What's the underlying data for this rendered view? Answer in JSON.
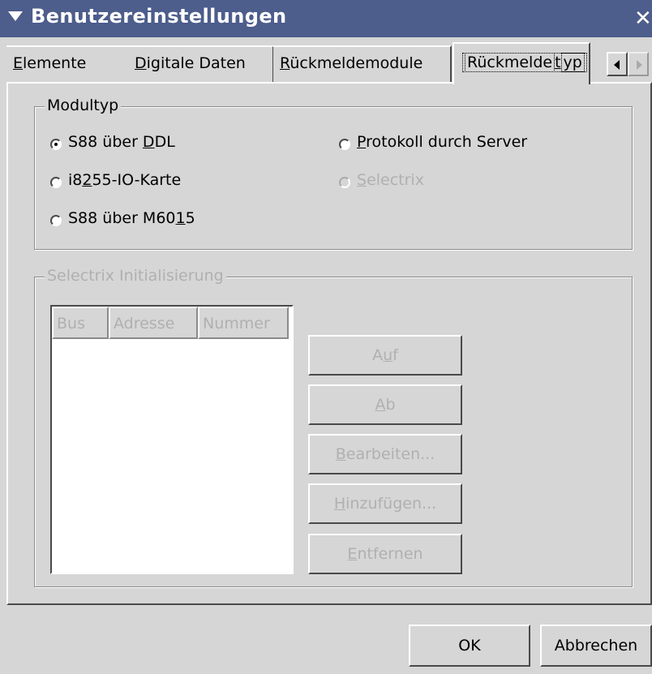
{
  "window": {
    "title": "Benutzereinstellungen",
    "close_glyph": "✕"
  },
  "tabs": [
    {
      "pre": "",
      "u": "E",
      "post": "lemente"
    },
    {
      "pre": "",
      "u": "D",
      "post": "igitale Daten"
    },
    {
      "pre": "",
      "u": "R",
      "post": "ückmeldemodule"
    },
    {
      "pre": "Rückmelde",
      "u": "t",
      "post": "yp"
    }
  ],
  "active_tab": "Rückmeldetyp",
  "modultyp": {
    "legend": "Modultyp",
    "options": [
      {
        "pre": "S88 über ",
        "u": "D",
        "post": "DL",
        "selected": true,
        "enabled": true
      },
      {
        "pre": "i8",
        "u": "2",
        "post": "55-IO-Karte",
        "selected": false,
        "enabled": true
      },
      {
        "pre": "S88 über M60",
        "u": "1",
        "post": "5",
        "selected": false,
        "enabled": true
      },
      {
        "pre": "",
        "u": "P",
        "post": "rotokoll durch Server",
        "selected": false,
        "enabled": true
      },
      {
        "pre": "",
        "u": "S",
        "post": "electrix",
        "selected": false,
        "enabled": false
      }
    ]
  },
  "selectrix": {
    "legend": "Selectrix Initialisierung",
    "columns": [
      "Bus",
      "Adresse",
      "Nummer"
    ],
    "rows": [],
    "buttons": [
      {
        "pre": "A",
        "u": "u",
        "post": "f"
      },
      {
        "pre": "",
        "u": "A",
        "post": "b"
      },
      {
        "pre": "",
        "u": "B",
        "post": "earbeiten..."
      },
      {
        "pre": "",
        "u": "H",
        "post": "inzufügen..."
      },
      {
        "pre": "",
        "u": "E",
        "post": "ntfernen"
      }
    ]
  },
  "footer": {
    "ok": "OK",
    "cancel": "Abbrechen"
  },
  "colors": {
    "titlebar": "#4d5d8c",
    "background": "#d6d6d6",
    "disabled_text": "#b0b0b0"
  },
  "icons": {
    "title_menu": "triangle-down-icon",
    "close": "close-icon",
    "scroll_left": "arrow-left-icon",
    "scroll_right": "arrow-right-icon"
  }
}
